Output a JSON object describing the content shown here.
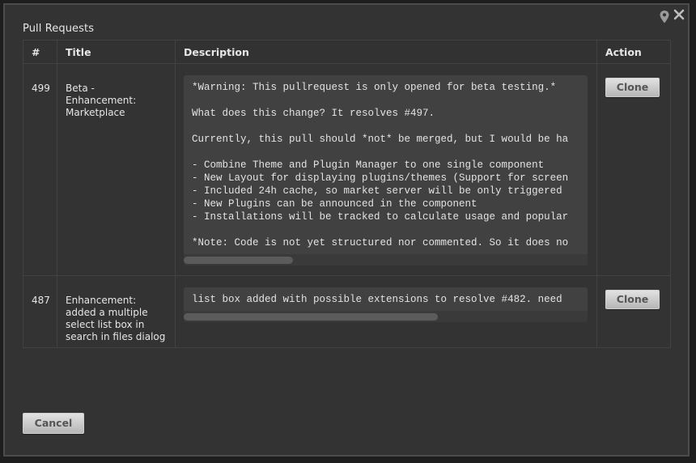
{
  "dialog": {
    "title": "Pull Requests",
    "icons": {
      "pin": "map-pin-icon",
      "close": "close-icon"
    }
  },
  "table": {
    "headers": {
      "num": "#",
      "title": "Title",
      "description": "Description",
      "action": "Action"
    },
    "rows": [
      {
        "number": "499",
        "title": "Beta - Enhancement: Marketplace",
        "description": "*Warning: This pullrequest is only opened for beta testing.*\n\nWhat does this change? It resolves #497.\n\nCurrently, this pull should *not* be merged, but I would be ha\n\n- Combine Theme and Plugin Manager to one single component\n- New Layout for displaying plugins/themes (Support for screen\n- Included 24h cache, so market server will be only triggered\n- New Plugins can be announced in the component\n- Installations will be tracked to calculate usage and popular\n\n*Note: Code is not yet structured nor commented. So it does no",
        "action_label": "Clone",
        "scroll_fraction": 0.27
      },
      {
        "number": "487",
        "title": "Enhancement: added a multiple select list box in search in files dialog",
        "description": "list box added with possible extensions to resolve #482. need",
        "action_label": "Clone",
        "scroll_fraction": 0.63
      }
    ]
  },
  "footer": {
    "cancel_label": "Cancel"
  },
  "colors": {
    "dialog_bg": "#333333",
    "text": "#e6e6e6",
    "code_bg": "#414141",
    "button_bg": "#d0d0d0"
  }
}
